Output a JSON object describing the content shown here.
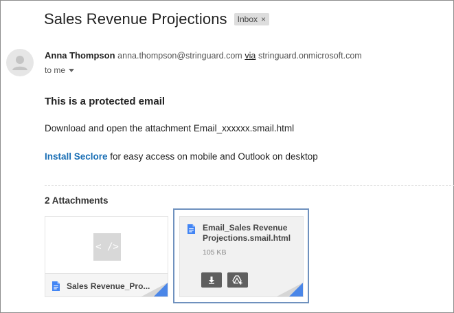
{
  "email": {
    "subject": "Sales Revenue Projections",
    "label": "Inbox",
    "label_remove": "×",
    "sender": {
      "name": "Anna Thompson",
      "email": "anna.thompson@stringuard.com",
      "via_text": "via",
      "via_domain": "stringuard.onmicrosoft.com"
    },
    "recipient_text": "to me"
  },
  "body": {
    "heading": "This is a protected email",
    "line1": "Download and open the attachment Email_xxxxxx.smail.html",
    "install_link": "Install Seclore",
    "line2_rest": " for easy access on mobile and Outlook on desktop"
  },
  "attachments": {
    "heading": "2 Attachments",
    "items": [
      {
        "name": "Sales Revenue_Pro...",
        "preview_glyph": "< />"
      },
      {
        "name": "Email_Sales Revenue Projections.smail.html",
        "size": "105 KB"
      }
    ]
  },
  "colors": {
    "link": "#1a6fb5",
    "doc_icon": "#4285f4",
    "selection_outline": "#6f91be",
    "action_button": "#5f5f5f"
  },
  "icons": {
    "avatar": "person-icon",
    "file": "google-doc-icon",
    "download": "download-icon",
    "drive": "add-to-drive-icon",
    "caret": "caret-down-icon"
  }
}
